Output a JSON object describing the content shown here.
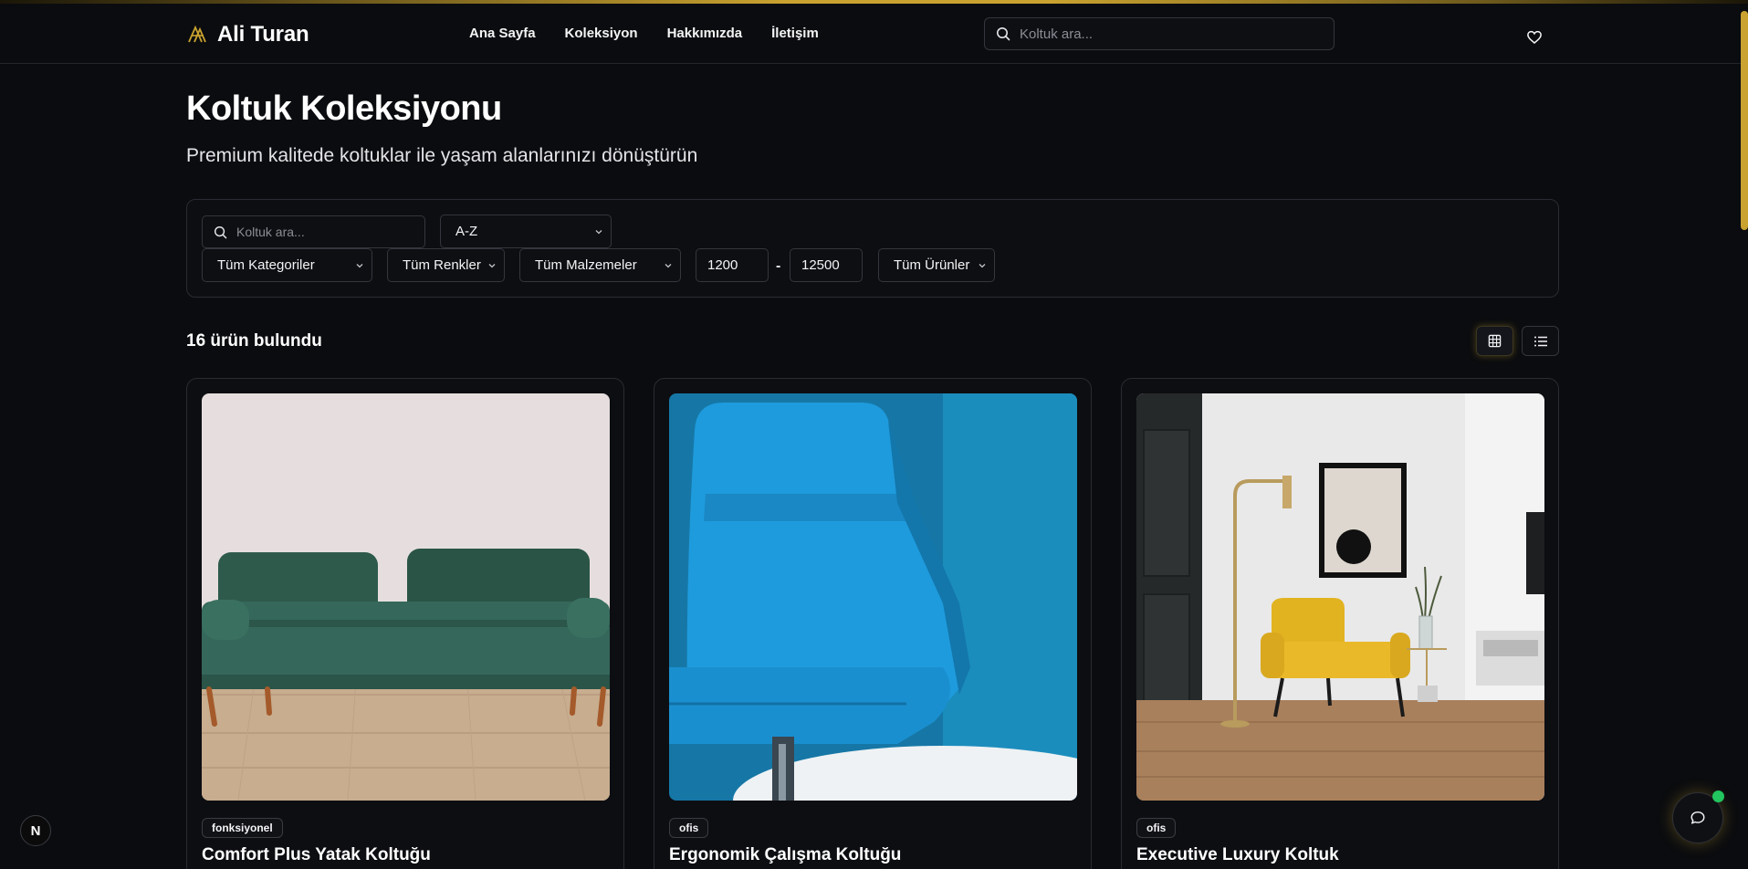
{
  "brand": {
    "name": "Ali Turan",
    "accent": "#c9a22f"
  },
  "nav": [
    {
      "label": "Ana Sayfa"
    },
    {
      "label": "Koleksiyon"
    },
    {
      "label": "Hakkımızda"
    },
    {
      "label": "İletişim"
    }
  ],
  "header_search": {
    "placeholder": "Koltuk ara..."
  },
  "page": {
    "title": "Koltuk Koleksiyonu",
    "subtitle": "Premium kalitede koltuklar ile yaşam alanlarınızı dönüştürün"
  },
  "filters": {
    "search_placeholder": "Koltuk ara...",
    "sort": "A-Z",
    "category": "Tüm Kategoriler",
    "color": "Tüm Renkler",
    "material": "Tüm Malzemeler",
    "price_min": "1200",
    "price_separator": "-",
    "price_max": "12500",
    "availability": "Tüm Ürünler"
  },
  "results": {
    "count_label": "16 ürün bulundu",
    "view_mode": "grid"
  },
  "products": [
    {
      "badge": "fonksiyonel",
      "title": "Comfort Plus Yatak Koltuğu",
      "image": "green-velvet-sofa"
    },
    {
      "badge": "ofis",
      "title": "Ergonomik Çalışma Koltuğu",
      "image": "blue-office-chair"
    },
    {
      "badge": "ofis",
      "title": "Executive Luxury Koltuk",
      "image": "yellow-armchair-room"
    }
  ],
  "icons": {
    "logo": "logo-icon",
    "search": "search-icon",
    "favorites": "heart-icon",
    "grid_view": "grid-icon",
    "list_view": "list-icon",
    "chat": "chat-icon",
    "dev_indicator": "next-logo-icon"
  },
  "status_colors": {
    "online": "#22c55e"
  },
  "dev_indicator_label": "N"
}
